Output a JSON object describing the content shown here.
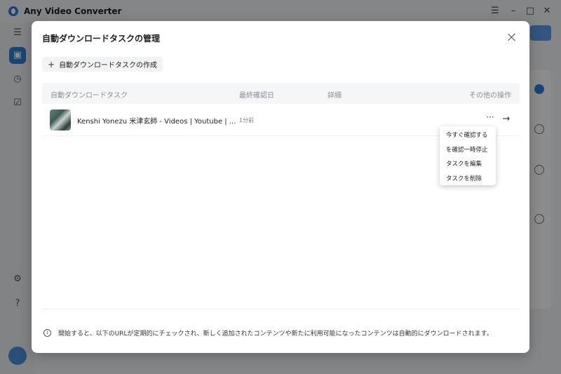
{
  "app": {
    "title": "Any Video Converter",
    "colors": {
      "accent": "#2f7fd8",
      "overlay": "rgba(0,0,0,0.45)"
    },
    "window_controls": [
      "menu-icon",
      "minimize-icon",
      "maximize-icon",
      "close-icon"
    ],
    "sidebar_icons": [
      "menu-icon",
      "toolbox-icon",
      "clock-icon",
      "checklist-icon",
      "gear-icon",
      "help-icon",
      "avatar"
    ]
  },
  "modal": {
    "title": "自動ダウンロードタスクの管理",
    "create_button": "自動ダウンロードタスクの作成",
    "columns": [
      "自動ダウンロードタスク",
      "最終確認日",
      "詳細",
      "その他の操作"
    ],
    "tasks": [
      {
        "name": "Kenshi Yonezu 米津玄師 - Videos | Youtube | ...",
        "last_checked": "1分前"
      }
    ],
    "context_menu": [
      "今すぐ確認する",
      "を確認一時停止",
      "タスクを編集",
      "タスクを削除"
    ],
    "footer_note": "開始すると、以下のURLが定期的にチェックされ、新しく追加されたコンテンツや新たに利用可能になったコンテンツは自動的にダウンロードされます。"
  }
}
